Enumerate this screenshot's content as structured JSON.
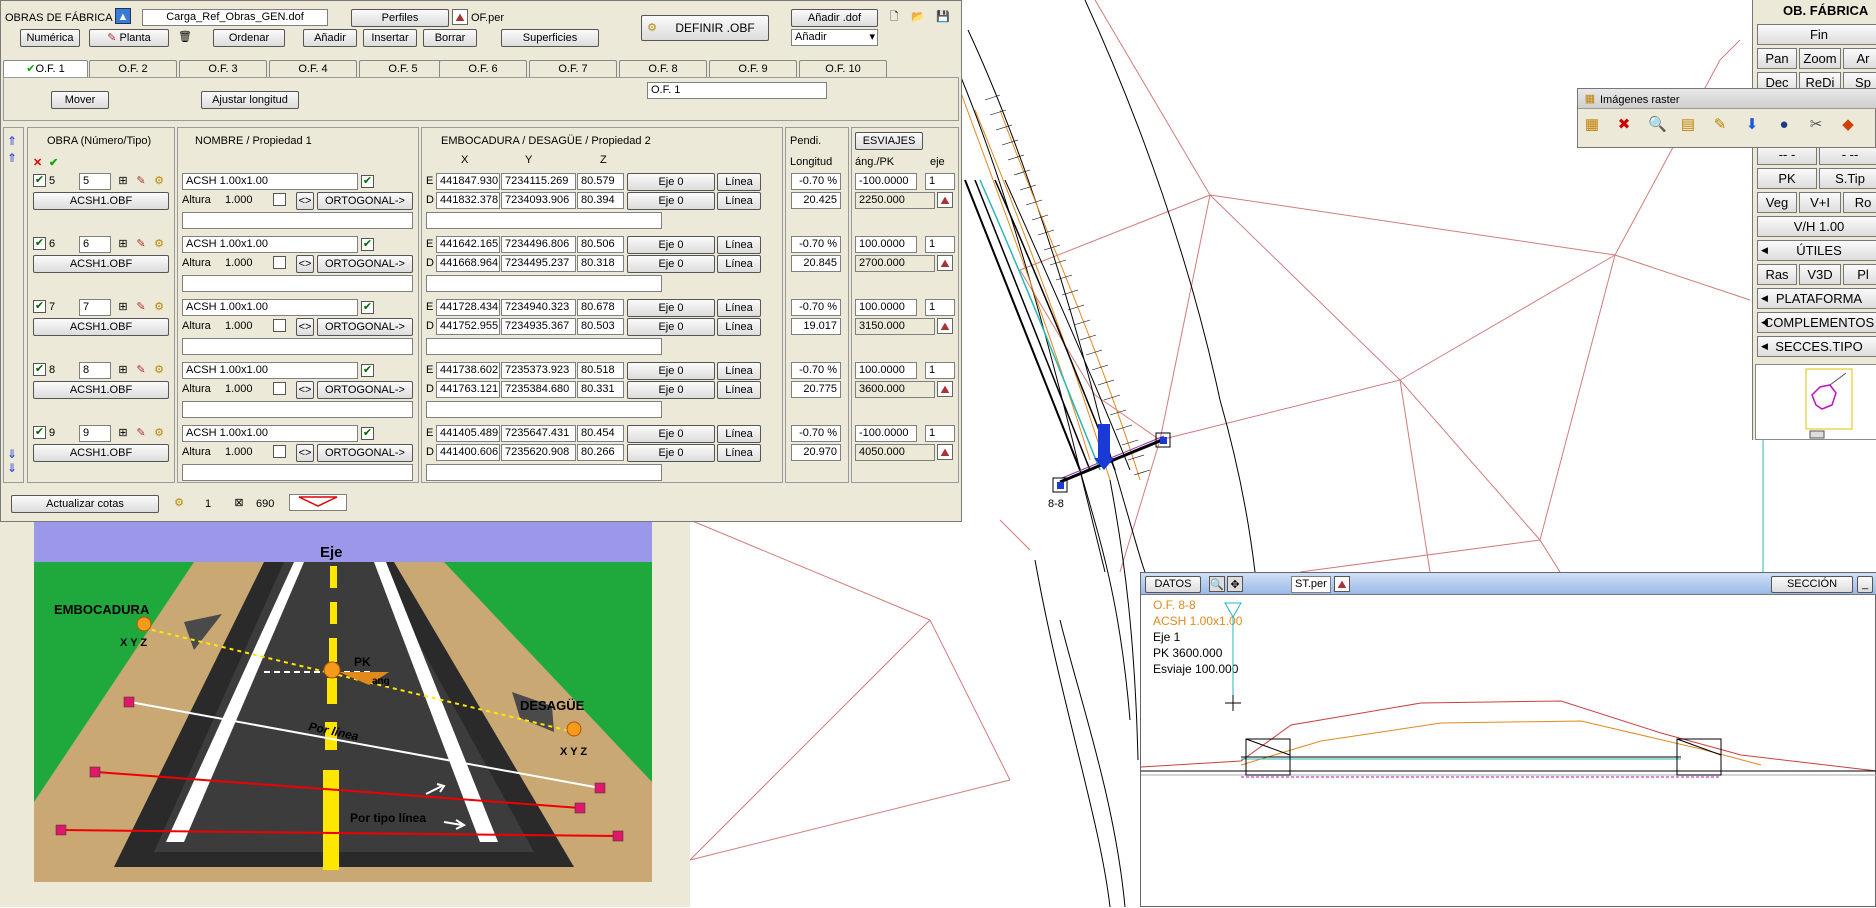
{
  "panel": {
    "title": "OBRAS DE FÁBRICA",
    "file_name": "Carga_Ref_Obras_GEN.dof",
    "perfiles_label": "Perfiles",
    "of_per_label": "OF.per",
    "definir_label": "DEFINIR .OBF",
    "anadir_dof_label": "Añadir .dof",
    "anadir_select": "Añadir",
    "numerica_label": "Numérica",
    "planta_label": "Planta",
    "ordenar_label": "Ordenar",
    "anadir_label": "Añadir",
    "insertar_label": "Insertar",
    "borrar_label": "Borrar",
    "superficies_label": "Superficies",
    "mover_label": "Mover",
    "ajustar_label": "Ajustar longitud",
    "current_of": "O.F. 1",
    "tabs": [
      "O.F. 1",
      "O.F. 2",
      "O.F. 3",
      "O.F. 4",
      "O.F. 5",
      "O.F. 6",
      "O.F. 7",
      "O.F. 8",
      "O.F. 9",
      "O.F. 10"
    ],
    "hdr_obra": "OBRA (Número/Tipo)",
    "hdr_nombre": "NOMBRE / Propiedad 1",
    "hdr_emb": "EMBOCADURA / DESAGÜE / Propiedad 2",
    "hdr_x": "X",
    "hdr_y": "Y",
    "hdr_z": "Z",
    "hdr_pendi": "Pendi.",
    "hdr_longitud": "Longitud",
    "esviajes_label": "ESVIAJES",
    "hdr_ang": "áng./PK",
    "hdr_eje": "eje",
    "altura_label": "Altura",
    "e_label": "E",
    "d_label": "D",
    "actualizar_label": "Actualizar cotas",
    "status_count": "1",
    "status_value": "690",
    "rows": [
      {
        "num": "5",
        "num2": "5",
        "obf": "ACSH1.OBF",
        "name": "ACSH 1.00x1.00",
        "altura": "1.000",
        "orto": "ORTOGONAL->",
        "ex": "441847.930",
        "ey": "7234115.269",
        "ez": "80.579",
        "dx": "441832.378",
        "dy": "7234093.906",
        "dz": "80.394",
        "eje_btn": "Eje 0",
        "linea_btn": "Línea",
        "pend": "-0.70 %",
        "long": "20.425",
        "ang": "-100.0000",
        "eje": "1",
        "pk": "2250.000"
      },
      {
        "num": "6",
        "num2": "6",
        "obf": "ACSH1.OBF",
        "name": "ACSH 1.00x1.00",
        "altura": "1.000",
        "orto": "ORTOGONAL->",
        "ex": "441642.165",
        "ey": "7234496.806",
        "ez": "80.506",
        "dx": "441668.964",
        "dy": "7234495.237",
        "dz": "80.318",
        "eje_btn": "Eje 0",
        "linea_btn": "Línea",
        "pend": "-0.70 %",
        "long": "20.845",
        "ang": "100.0000",
        "eje": "1",
        "pk": "2700.000"
      },
      {
        "num": "7",
        "num2": "7",
        "obf": "ACSH1.OBF",
        "name": "ACSH 1.00x1.00",
        "altura": "1.000",
        "orto": "ORTOGONAL->",
        "ex": "441728.434",
        "ey": "7234940.323",
        "ez": "80.678",
        "dx": "441752.955",
        "dy": "7234935.367",
        "dz": "80.503",
        "eje_btn": "Eje 0",
        "linea_btn": "Línea",
        "pend": "-0.70 %",
        "long": "19.017",
        "ang": "100.0000",
        "eje": "1",
        "pk": "3150.000"
      },
      {
        "num": "8",
        "num2": "8",
        "obf": "ACSH1.OBF",
        "name": "ACSH 1.00x1.00",
        "altura": "1.000",
        "orto": "ORTOGONAL->",
        "ex": "441738.602",
        "ey": "7235373.923",
        "ez": "80.518",
        "dx": "441763.121",
        "dy": "7235384.680",
        "dz": "80.331",
        "eje_btn": "Eje 0",
        "linea_btn": "Línea",
        "pend": "-0.70 %",
        "long": "20.775",
        "ang": "100.0000",
        "eje": "1",
        "pk": "3600.000"
      },
      {
        "num": "9",
        "num2": "9",
        "obf": "ACSH1.OBF",
        "name": "ACSH 1.00x1.00",
        "altura": "1.000",
        "orto": "ORTOGONAL->",
        "ex": "441405.489",
        "ey": "7235647.431",
        "ez": "80.454",
        "dx": "441400.606",
        "dy": "7235620.908",
        "dz": "80.266",
        "eje_btn": "Eje 0",
        "linea_btn": "Línea",
        "pend": "-0.70 %",
        "long": "20.970",
        "ang": "-100.0000",
        "eje": "1",
        "pk": "4050.000"
      }
    ]
  },
  "diagram": {
    "eje": "Eje",
    "embocadura": "EMBOCADURA",
    "desague": "DESAGÜE",
    "xyz_left": "X Y Z",
    "xyz_right": "X Y Z",
    "pk": "PK",
    "ang": "ang",
    "por_linea": "Por línea",
    "por_tipo_linea": "Por tipo línea"
  },
  "right_panel": {
    "title": "OB. FÁBRICA",
    "fin": "Fin",
    "pan": "Pan",
    "zoom": "Zoom",
    "ar": "Ar",
    "dec": "Dec",
    "redi": "ReDi",
    "sp": "Sp",
    "dash1": "-- -",
    "dash2": "- --",
    "pk": "PK",
    "stip": "S.Tip",
    "veg": "Veg",
    "vi": "V+I",
    "ro": "Ro",
    "vh": "V/H 1.00",
    "utiles": "ÚTILES",
    "ras": "Ras",
    "v3d": "V3D",
    "pl": "Pl",
    "plataforma": "PLATAFORMA",
    "complementos": "COMPLEMENTOS",
    "secces": "SECCES.TIPO"
  },
  "raster": {
    "title": "Imágenes raster"
  },
  "section_window": {
    "datos": "DATOS",
    "st_per": "ST.per",
    "seccion": "SECCIÓN",
    "of_label": "O.F. 8-8",
    "acsh_label": "ACSH 1.00x1.00",
    "eje_label": "Eje 1",
    "pk_label": "PK 3600.000",
    "esviaje_label": "Esviaje 100.000"
  },
  "map": {
    "marker_label": "8-8"
  },
  "colors": {
    "panel_bg": "#ece9d8",
    "accent_orange": "#e08a1e",
    "grid_red": "#c86060",
    "cyan": "#2ab5b5"
  }
}
